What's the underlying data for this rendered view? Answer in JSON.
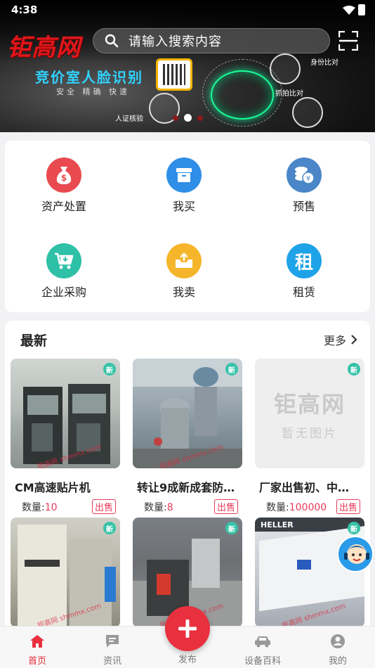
{
  "status": {
    "time": "4:38"
  },
  "header": {
    "logo": "钜高网",
    "search_placeholder": "请输入搜索内容"
  },
  "banner": {
    "title": "竞价室人脸识别",
    "subtitle": "安全 精确 快速",
    "tags": [
      "身份比对",
      "抓拍比对",
      "人证核验"
    ]
  },
  "categories": [
    {
      "label": "资产处置",
      "icon": "money-bag-icon",
      "color": "#e84a4f"
    },
    {
      "label": "我买",
      "icon": "box-icon",
      "color": "#2f8fe8"
    },
    {
      "label": "预售",
      "icon": "coins-icon",
      "color": "#4a86c8"
    },
    {
      "label": "企业采购",
      "icon": "cart-icon",
      "color": "#2fc0a8"
    },
    {
      "label": "我卖",
      "icon": "upload-box-icon",
      "color": "#f5b52a"
    },
    {
      "label": "租赁",
      "icon": "rent-icon",
      "glyph": "租",
      "color": "#1fa3e8"
    }
  ],
  "latest": {
    "title": "最新",
    "more": "更多",
    "new_badge": "新",
    "watermark": "钜高网 shmmx.com",
    "products": [
      {
        "name": "CM高速贴片机",
        "qty_label": "数量:",
        "qty": "10",
        "tag": "出售"
      },
      {
        "name": "转让9成新成套防…",
        "qty_label": "数量:",
        "qty": "8",
        "tag": "出售"
      },
      {
        "name": "厂家出售初、中…",
        "qty_label": "数量:",
        "qty": "100000",
        "tag": "出售",
        "placeholder_logo": "钜高网",
        "placeholder_text": "暂无图片"
      },
      {
        "name": "",
        "qty": "",
        "tag": ""
      },
      {
        "name": "",
        "qty": "",
        "tag": ""
      },
      {
        "name": "",
        "qty": "",
        "tag": "",
        "brand": "HELLER"
      }
    ]
  },
  "nav": {
    "items": [
      {
        "label": "首页",
        "icon": "home-icon"
      },
      {
        "label": "资讯",
        "icon": "message-icon"
      },
      {
        "label": "发布",
        "icon": "plus-icon"
      },
      {
        "label": "设备百科",
        "icon": "car-icon"
      },
      {
        "label": "我的",
        "icon": "user-icon"
      }
    ],
    "active": "首页",
    "accent": "#e8303e"
  }
}
